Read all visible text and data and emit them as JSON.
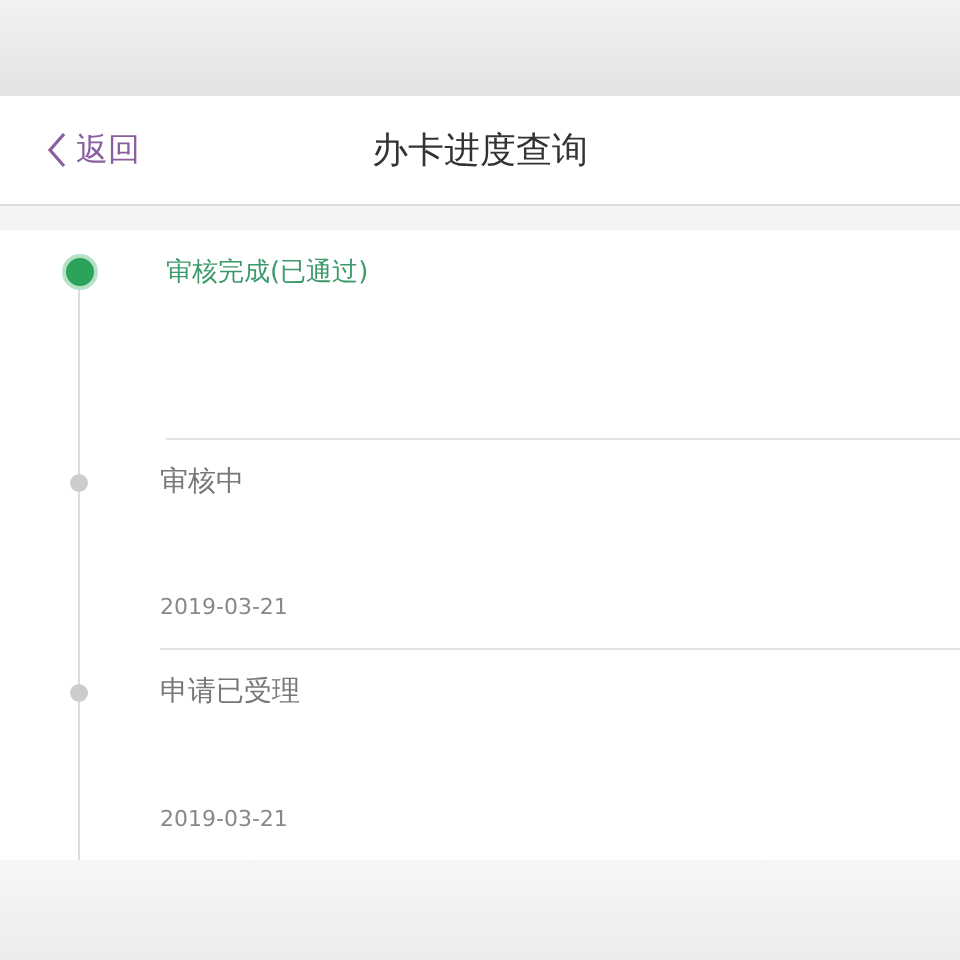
{
  "nav": {
    "back": "返回",
    "title": "办卡进度查询"
  },
  "steps": [
    {
      "status": "审核完成(已通过)",
      "done": true
    },
    {
      "status": "审核中",
      "done": false,
      "date": "2019-03-21"
    },
    {
      "status": "申请已受理",
      "done": false,
      "date": "2019-03-21"
    }
  ]
}
